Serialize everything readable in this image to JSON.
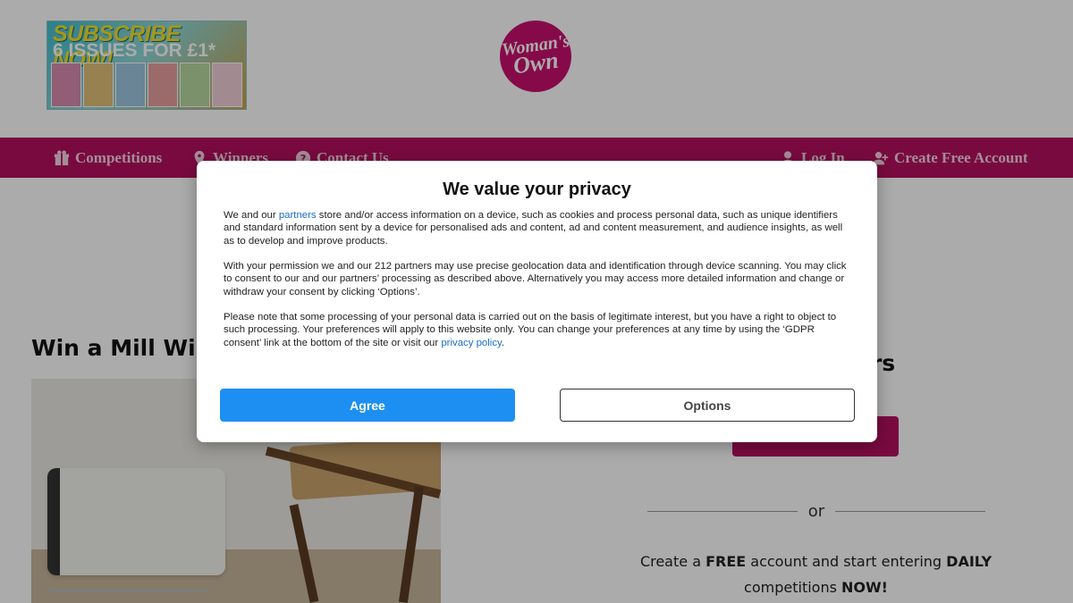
{
  "header": {
    "promo": {
      "line1": "SUBSCRIBE NOW!",
      "line2": "6 ISSUES FOR £1*"
    },
    "logo": {
      "line1": "Woman's",
      "line2": "Own"
    }
  },
  "nav": {
    "competitions": "Competitions",
    "winners": "Winners",
    "contact": "Contact Us",
    "login": "Log In",
    "create_account": "Create Free Account"
  },
  "page": {
    "title": "Win a Mill WiFi",
    "sub_heading": "ers",
    "or": "or",
    "cta": {
      "p1": "Create a ",
      "free": "FREE",
      "p2": " account and start entering ",
      "daily": "DAILY",
      "p3": "competitions ",
      "now": "NOW!"
    }
  },
  "consent": {
    "title": "We value your privacy",
    "p1_before": "We and our ",
    "p1_link": "partners",
    "p1_after": " store and/or access information on a device, such as cookies and process personal data, such as unique identifiers and standard information sent by a device for personalised ads and content, ad and content measurement, and audience insights, as well as to develop and improve products.",
    "p2": "With your permission we and our 212 partners may use precise geolocation data and identification through device scanning. You may click to consent to our and our partners’ processing as described above. Alternatively you may access more detailed information and change or withdraw your consent by clicking ‘Options’.",
    "p3_before": "Please note that some processing of your personal data is carried out on the basis of legitimate interest, but you have a right to object to such processing. Your preferences will apply to this website only. You can change your preferences at any time by using the ‘GDPR consent’ link at the bottom of the site or visit our ",
    "p3_link": "privacy policy",
    "p3_after": ".",
    "agree": "Agree",
    "options": "Options"
  },
  "colors": {
    "brand": "#b5105e",
    "agree_button": "#1e8ff2",
    "link": "#1a6fc9"
  },
  "icons": {
    "competitions": "gift-icon",
    "winners": "location-pin-icon",
    "contact": "question-circle-icon",
    "login": "user-icon",
    "create_account": "user-plus-icon"
  }
}
